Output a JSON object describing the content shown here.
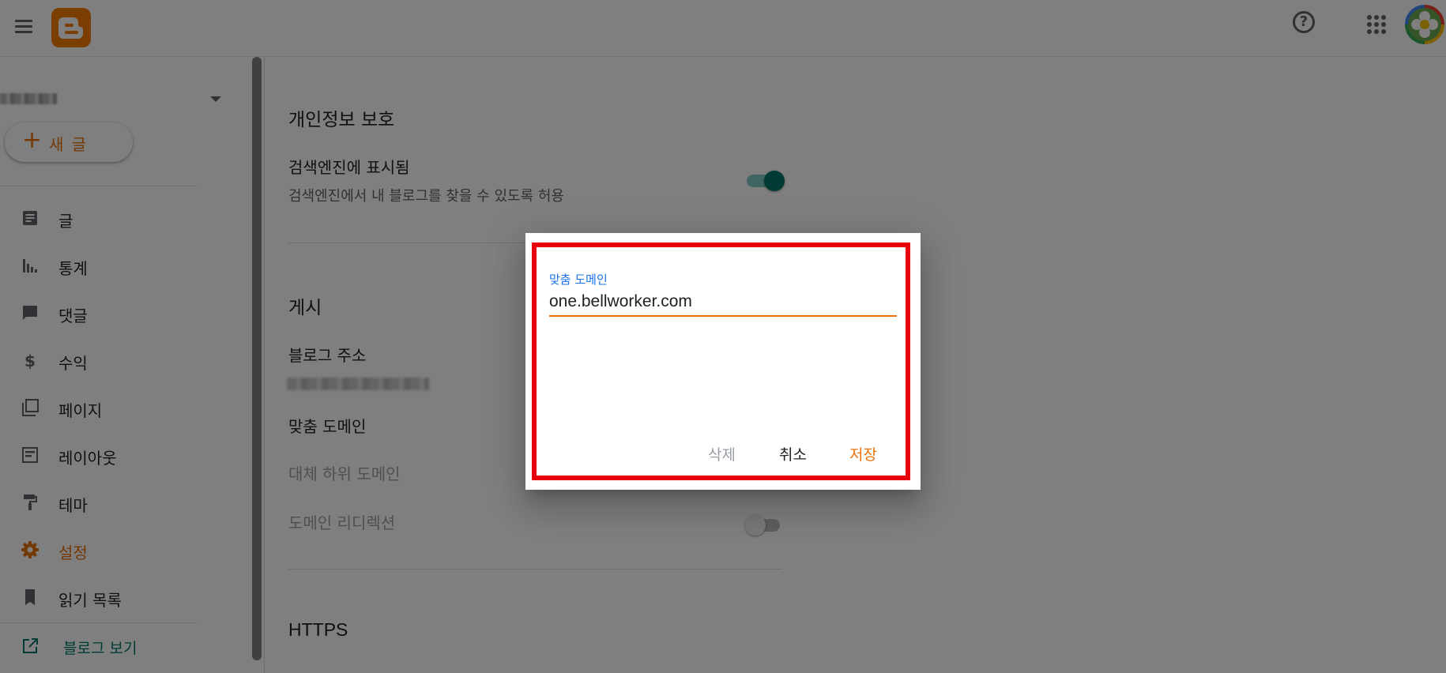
{
  "sidebar": {
    "new_post_label": "새 글",
    "items": [
      {
        "label": "글",
        "icon": "posts-icon"
      },
      {
        "label": "통계",
        "icon": "stats-icon"
      },
      {
        "label": "댓글",
        "icon": "comments-icon"
      },
      {
        "label": "수익",
        "icon": "dollar-icon"
      },
      {
        "label": "페이지",
        "icon": "pages-icon"
      },
      {
        "label": "레이아웃",
        "icon": "layout-icon"
      },
      {
        "label": "테마",
        "icon": "theme-roller-icon"
      },
      {
        "label": "설정",
        "icon": "gear-icon",
        "active": true
      },
      {
        "label": "읽기 목록",
        "icon": "bookmark-icon"
      }
    ],
    "view_blog_label": "블로그 보기"
  },
  "main": {
    "privacy": {
      "title": "개인정보 보호",
      "search_visible_title": "검색엔진에 표시됨",
      "search_visible_desc": "검색엔진에서 내 블로그를 찾을 수 있도록 허용",
      "search_visible_on": true
    },
    "publishing": {
      "title": "게시",
      "blog_address_label": "블로그 주소",
      "custom_domain_label": "맞춤 도메인",
      "fallback_subdomain_label": "대체 하위 도메인",
      "domain_redirect_label": "도메인 리디렉션",
      "domain_redirect_on": false
    },
    "https_title": "HTTPS"
  },
  "dialog": {
    "field_label": "맞춤 도메인",
    "field_value": "one.bellworker.com",
    "delete_label": "삭제",
    "cancel_label": "취소",
    "save_label": "저장"
  },
  "colors": {
    "accent": "#e8710a",
    "teal": "#00796b",
    "highlight": "#e8000b",
    "link_blue": "#1a73e8"
  }
}
